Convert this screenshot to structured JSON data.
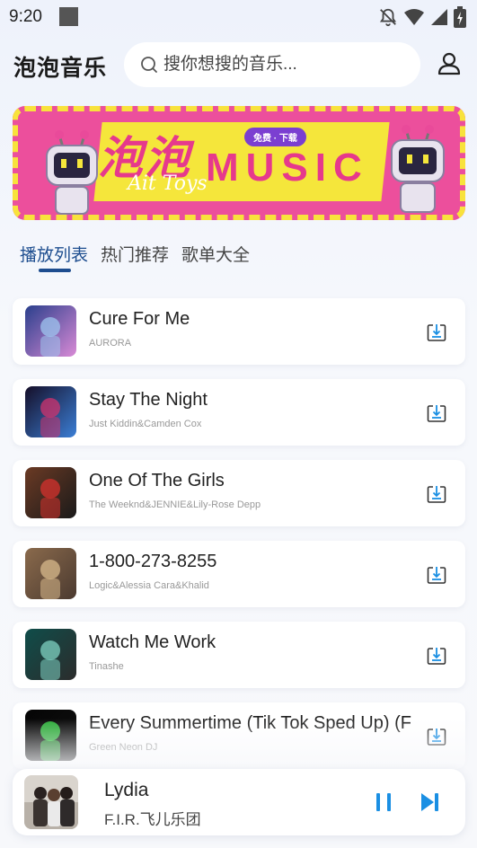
{
  "status_bar": {
    "time": "9:20"
  },
  "header": {
    "app_title": "泡泡音乐",
    "search_placeholder": "搜你想搜的音乐..."
  },
  "banner": {
    "title": "泡泡",
    "music_text": "MUSIC",
    "brand": "Ait Toys",
    "badge": "免费 · 下载"
  },
  "tabs": [
    {
      "label": "播放列表",
      "active": true
    },
    {
      "label": "热门推荐",
      "active": false
    },
    {
      "label": "歌单大全",
      "active": false
    }
  ],
  "songs": [
    {
      "title": "Cure For Me",
      "artist": "AURORA",
      "cover_colors": [
        "#2a3f8c",
        "#9ec6ef",
        "#d98ad6"
      ]
    },
    {
      "title": "Stay The Night",
      "artist": "Just Kiddin&Camden Cox",
      "cover_colors": [
        "#150e28",
        "#d0336e",
        "#3b7fd6"
      ]
    },
    {
      "title": "One Of The Girls",
      "artist": "The Weeknd&JENNIE&Lily-Rose Depp",
      "cover_colors": [
        "#6b3a24",
        "#d6322e",
        "#1a1a1a"
      ]
    },
    {
      "title": "1-800-273-8255",
      "artist": "Logic&Alessia Cara&Khalid",
      "cover_colors": [
        "#8a6a4c",
        "#d8b98c",
        "#4b3a30"
      ]
    },
    {
      "title": "Watch Me Work",
      "artist": "Tinashe",
      "cover_colors": [
        "#0f4d4a",
        "#7fd1c2",
        "#2c2c2c"
      ]
    },
    {
      "title": "Every Summertime (Tik Tok Sped Up) (F",
      "artist": "Green Neon DJ",
      "cover_colors": [
        "#050505",
        "#39e04a",
        "#101010"
      ]
    }
  ],
  "player": {
    "title": "Lydia",
    "artist": "F.I.R.飞儿乐团"
  },
  "colors": {
    "accent": "#1d4d8f",
    "control_blue": "#1a8fe3",
    "banner_pink": "#ec4f9c",
    "banner_yellow": "#f5e63b"
  }
}
